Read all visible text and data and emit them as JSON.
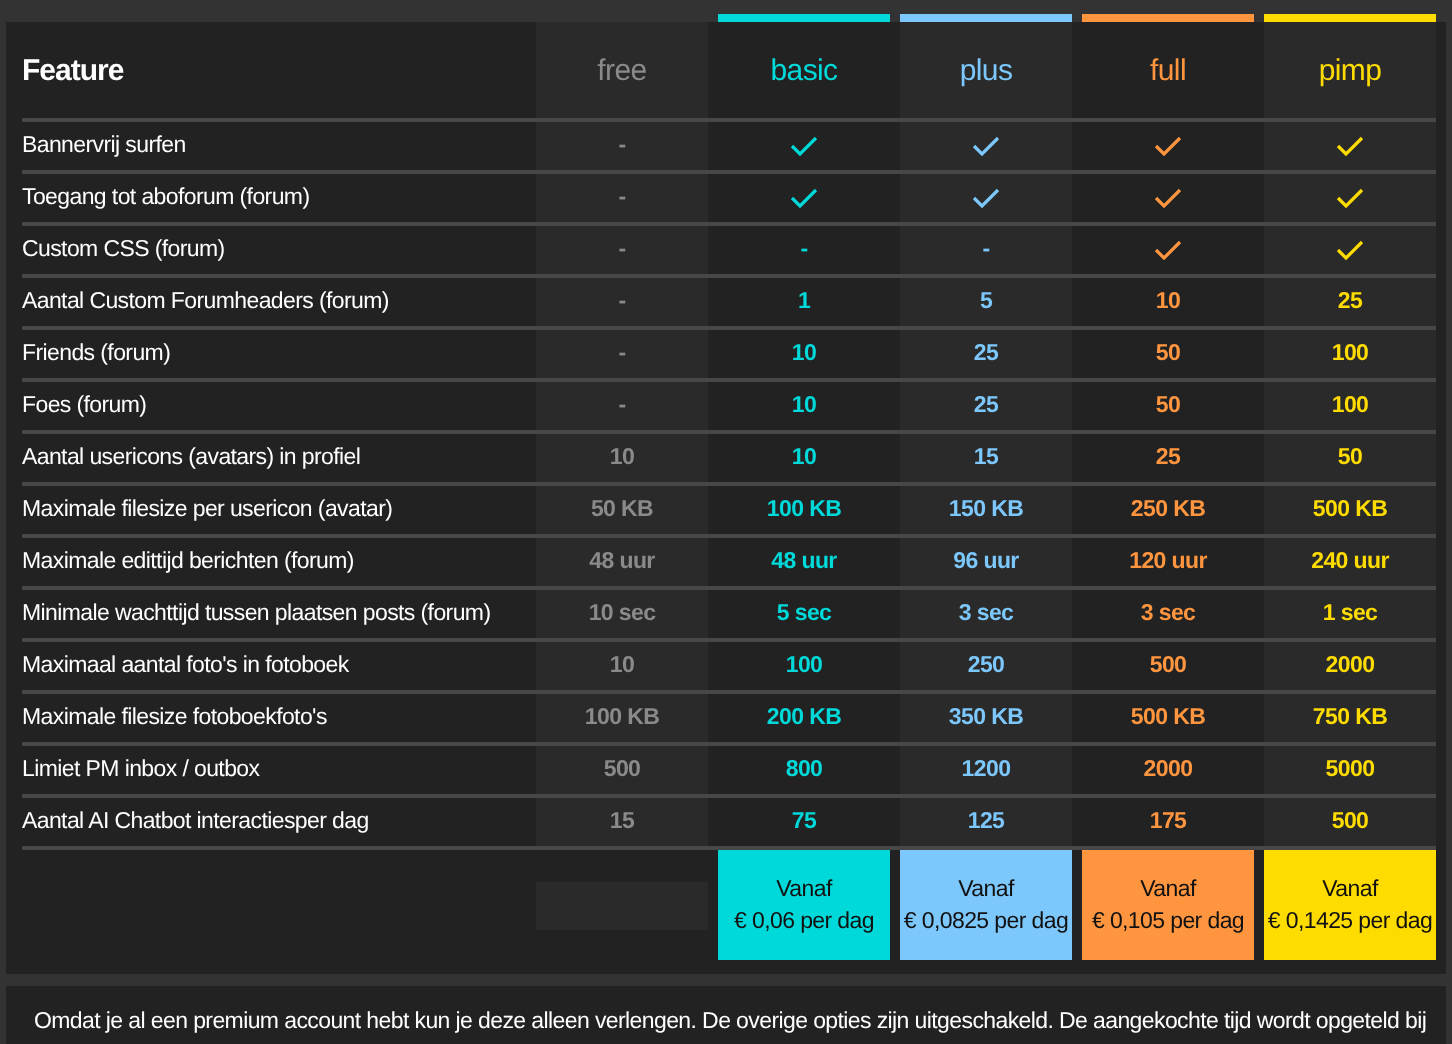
{
  "table": {
    "feature_heading": "Feature",
    "plans": [
      {
        "name": "free",
        "color": "#8a8a8a"
      },
      {
        "name": "basic",
        "color": "#00d9d9",
        "price_label": "Vanaf",
        "price": "€ 0,06 per dag"
      },
      {
        "name": "plus",
        "color": "#7cc7fb",
        "price_label": "Vanaf",
        "price": "€ 0,0825 per dag"
      },
      {
        "name": "full",
        "color": "#ff963f",
        "price_label": "Vanaf",
        "price": "€ 0,105 per dag"
      },
      {
        "name": "pimp",
        "color": "#ffdc00",
        "price_label": "Vanaf",
        "price": "€ 0,1425 per dag"
      }
    ],
    "rows": [
      {
        "feature": "Bannervrij surfen",
        "values": [
          {
            "kind": "text",
            "text": "-"
          },
          {
            "kind": "check"
          },
          {
            "kind": "check"
          },
          {
            "kind": "check"
          },
          {
            "kind": "check"
          }
        ]
      },
      {
        "feature": "Toegang tot aboforum (forum)",
        "values": [
          {
            "kind": "text",
            "text": "-"
          },
          {
            "kind": "check"
          },
          {
            "kind": "check"
          },
          {
            "kind": "check"
          },
          {
            "kind": "check"
          }
        ]
      },
      {
        "feature": "Custom CSS (forum)",
        "values": [
          {
            "kind": "text",
            "text": "-"
          },
          {
            "kind": "text",
            "text": "-"
          },
          {
            "kind": "text",
            "text": "-"
          },
          {
            "kind": "check"
          },
          {
            "kind": "check"
          }
        ]
      },
      {
        "feature": "Aantal Custom Forumheaders (forum)",
        "values": [
          {
            "kind": "text",
            "text": "-"
          },
          {
            "kind": "text",
            "text": "1"
          },
          {
            "kind": "text",
            "text": "5"
          },
          {
            "kind": "text",
            "text": "10"
          },
          {
            "kind": "text",
            "text": "25"
          }
        ]
      },
      {
        "feature": "Friends (forum)",
        "values": [
          {
            "kind": "text",
            "text": "-"
          },
          {
            "kind": "text",
            "text": "10"
          },
          {
            "kind": "text",
            "text": "25"
          },
          {
            "kind": "text",
            "text": "50"
          },
          {
            "kind": "text",
            "text": "100"
          }
        ]
      },
      {
        "feature": "Foes (forum)",
        "values": [
          {
            "kind": "text",
            "text": "-"
          },
          {
            "kind": "text",
            "text": "10"
          },
          {
            "kind": "text",
            "text": "25"
          },
          {
            "kind": "text",
            "text": "50"
          },
          {
            "kind": "text",
            "text": "100"
          }
        ]
      },
      {
        "feature": "Aantal usericons (avatars) in profiel",
        "values": [
          {
            "kind": "text",
            "text": "10"
          },
          {
            "kind": "text",
            "text": "10"
          },
          {
            "kind": "text",
            "text": "15"
          },
          {
            "kind": "text",
            "text": "25"
          },
          {
            "kind": "text",
            "text": "50"
          }
        ]
      },
      {
        "feature": "Maximale filesize per usericon (avatar)",
        "values": [
          {
            "kind": "text",
            "text": "50 KB"
          },
          {
            "kind": "text",
            "text": "100 KB"
          },
          {
            "kind": "text",
            "text": "150 KB"
          },
          {
            "kind": "text",
            "text": "250 KB"
          },
          {
            "kind": "text",
            "text": "500 KB"
          }
        ]
      },
      {
        "feature": "Maximale edittijd berichten (forum)",
        "values": [
          {
            "kind": "text",
            "text": "48 uur"
          },
          {
            "kind": "text",
            "text": "48 uur"
          },
          {
            "kind": "text",
            "text": "96 uur"
          },
          {
            "kind": "text",
            "text": "120 uur"
          },
          {
            "kind": "text",
            "text": "240 uur"
          }
        ]
      },
      {
        "feature": "Minimale wachttijd tussen plaatsen posts (forum)",
        "values": [
          {
            "kind": "text",
            "text": "10 sec"
          },
          {
            "kind": "text",
            "text": "5 sec"
          },
          {
            "kind": "text",
            "text": "3 sec"
          },
          {
            "kind": "text",
            "text": "3 sec"
          },
          {
            "kind": "text",
            "text": "1 sec"
          }
        ]
      },
      {
        "feature": "Maximaal aantal foto's in fotoboek",
        "values": [
          {
            "kind": "text",
            "text": "10"
          },
          {
            "kind": "text",
            "text": "100"
          },
          {
            "kind": "text",
            "text": "250"
          },
          {
            "kind": "text",
            "text": "500"
          },
          {
            "kind": "text",
            "text": "2000"
          }
        ]
      },
      {
        "feature": "Maximale filesize fotoboekfoto's",
        "values": [
          {
            "kind": "text",
            "text": "100 KB"
          },
          {
            "kind": "text",
            "text": "200 KB"
          },
          {
            "kind": "text",
            "text": "350 KB"
          },
          {
            "kind": "text",
            "text": "500 KB"
          },
          {
            "kind": "text",
            "text": "750 KB"
          }
        ]
      },
      {
        "feature": "Limiet PM inbox / outbox",
        "values": [
          {
            "kind": "text",
            "text": "500"
          },
          {
            "kind": "text",
            "text": "800"
          },
          {
            "kind": "text",
            "text": "1200"
          },
          {
            "kind": "text",
            "text": "2000"
          },
          {
            "kind": "text",
            "text": "5000"
          }
        ]
      },
      {
        "feature": "Aantal AI Chatbot interactiesper dag",
        "values": [
          {
            "kind": "text",
            "text": "15"
          },
          {
            "kind": "text",
            "text": "75"
          },
          {
            "kind": "text",
            "text": "125"
          },
          {
            "kind": "text",
            "text": "175"
          },
          {
            "kind": "text",
            "text": "500"
          }
        ]
      }
    ]
  },
  "notice": "Omdat je al een premium account hebt kun je deze alleen verlengen. De overige opties zijn uitgeschakeld. De aangekochte tijd wordt opgeteld bij"
}
